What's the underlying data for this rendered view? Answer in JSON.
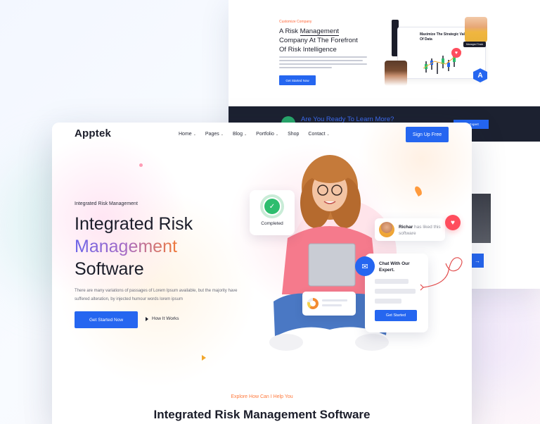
{
  "colors": {
    "primary": "#2566f0",
    "accent_orange": "#ff7a3d",
    "success": "#2dbd6e",
    "danger": "#ff4d5d",
    "dark": "#1b1d2a"
  },
  "back_preview": {
    "eyebrow": "Customize Company",
    "title_lines": [
      "A Risk",
      "Management",
      "Company At The Forefront",
      "Of Risk Intelligence"
    ],
    "button_label": "Get Started Now",
    "dashboard_title": "Maximize The Strategic Value Of Data",
    "avatar_tag": "Managed Track",
    "badge_letter": "A",
    "cta_text": "Are You Ready To Learn More?",
    "cta_button": "Get Expert",
    "arrow": "→"
  },
  "header": {
    "logo": "Apptek",
    "nav": [
      {
        "label": "Home",
        "has_dropdown": true
      },
      {
        "label": "Pages",
        "has_dropdown": true
      },
      {
        "label": "Blog",
        "has_dropdown": true
      },
      {
        "label": "Portfolio",
        "has_dropdown": true
      },
      {
        "label": "Shop",
        "has_dropdown": false
      },
      {
        "label": "Contact",
        "has_dropdown": true
      }
    ],
    "signup_label": "Sign Up Free",
    "chevron": "⌄"
  },
  "hero": {
    "eyebrow": "Integrated Risk Management",
    "title_line1": "Integrated Risk",
    "title_line2": "Management",
    "title_line3": "Software",
    "description": "There are many variations of passages of Lorem Ipsum available, but the majority have suffered alteration, by injected humour words lorem ipsum",
    "primary_cta": "Get Started Now",
    "secondary_cta": "How It Works"
  },
  "illustration": {
    "completed_label": "Completed",
    "completed_icon": "check-shield-icon",
    "liked_name": "Richar",
    "liked_text": "has liked this software",
    "heart_icon": "heart-icon",
    "chat_title": "Chat With Our Expert.",
    "chat_button": "Get Started",
    "check_glyph": "✓",
    "heart_glyph": "♥",
    "chat_glyph": "✉"
  },
  "next_section": {
    "eyebrow": "Explore How Can I Help You",
    "title": "Integrated Risk Management Software"
  }
}
